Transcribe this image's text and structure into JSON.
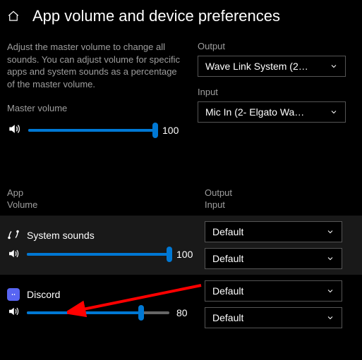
{
  "header": {
    "title": "App volume and device preferences"
  },
  "description": "Adjust the master volume to change all sounds. You can adjust volume for specific apps and system sounds as a percentage of the master volume.",
  "master": {
    "label": "Master volume",
    "value": 100
  },
  "outputField": {
    "label": "Output",
    "value": "Wave Link System (2…"
  },
  "inputField": {
    "label": "Input",
    "value": "Mic In (2- Elgato Wa…"
  },
  "columns": {
    "leftLine1": "App",
    "leftLine2": "Volume",
    "rightLine1": "Output",
    "rightLine2": "Input"
  },
  "apps": [
    {
      "name": "System sounds",
      "volume": 100,
      "output": "Default",
      "input": "Default"
    },
    {
      "name": "Discord",
      "volume": 80,
      "output": "Default",
      "input": "Default"
    }
  ]
}
